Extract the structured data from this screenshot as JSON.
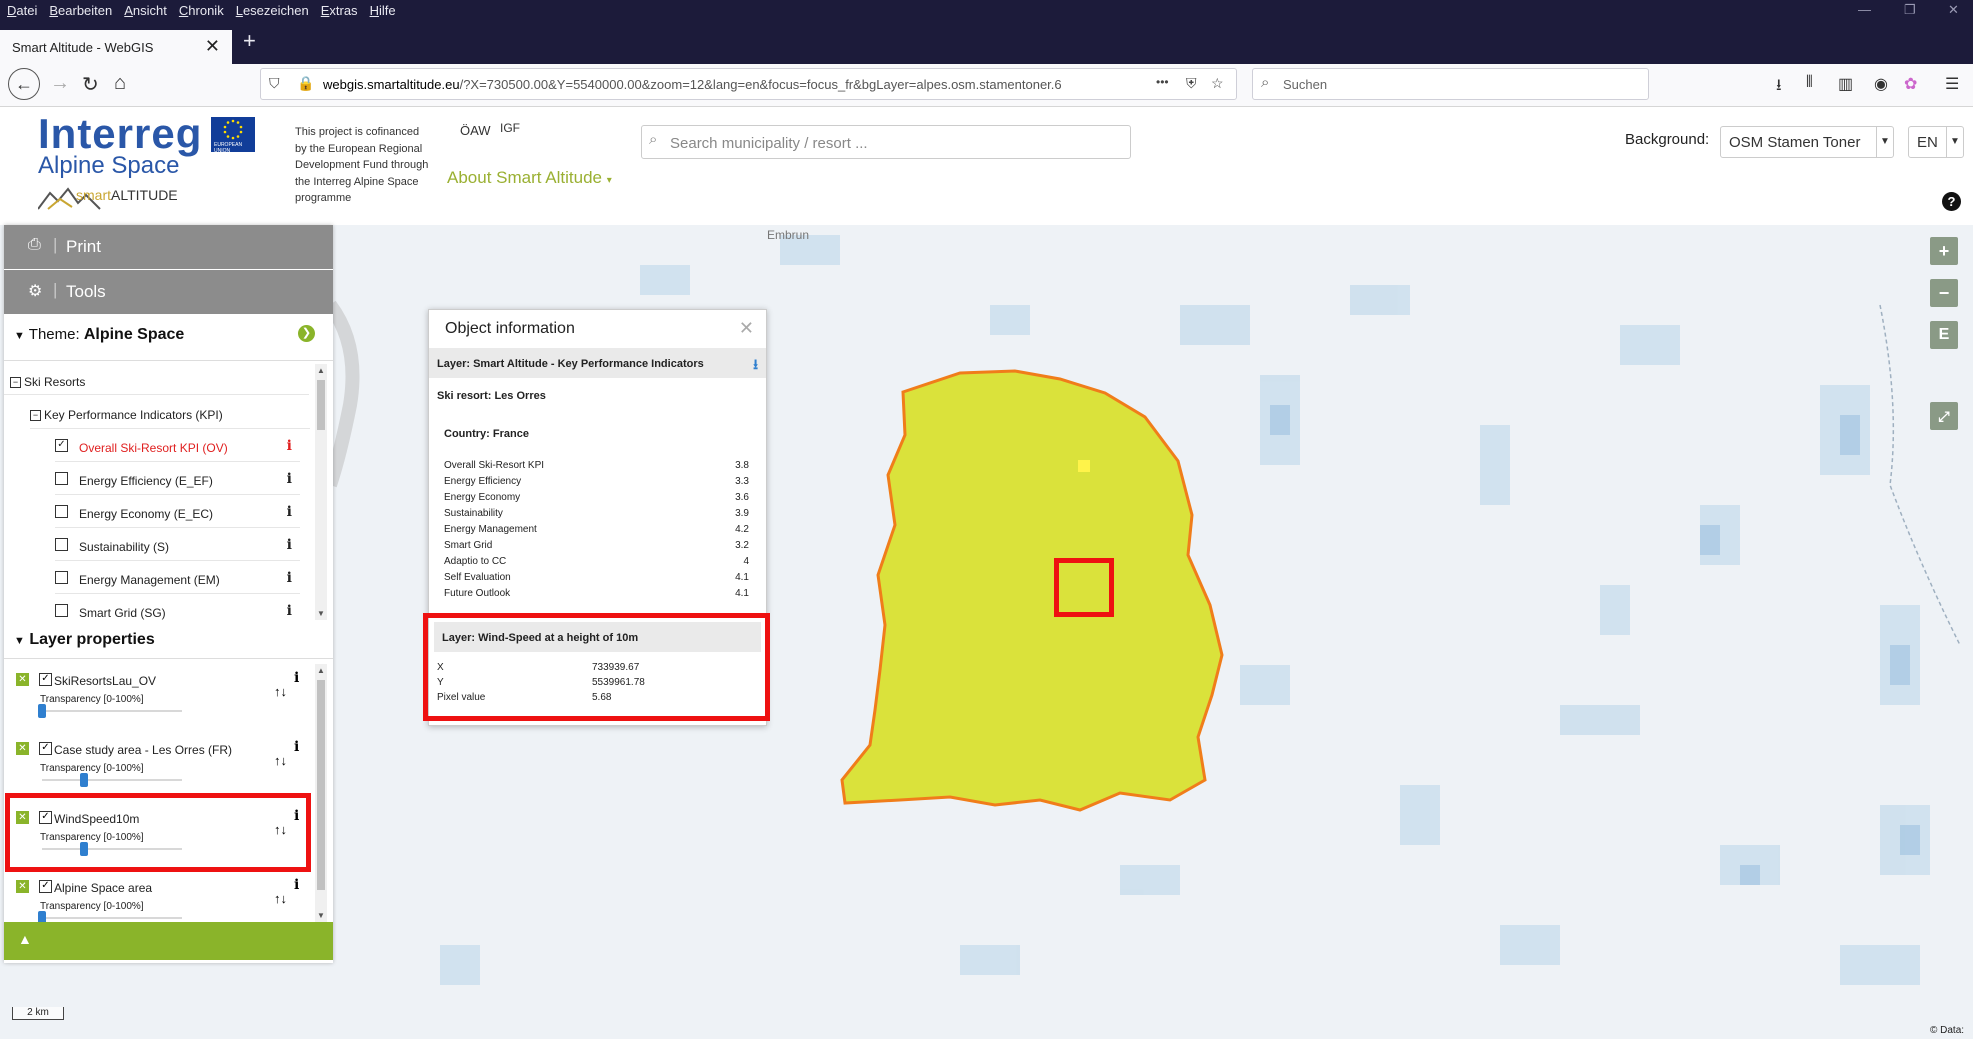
{
  "browser": {
    "menu": [
      "Datei",
      "Bearbeiten",
      "Ansicht",
      "Chronik",
      "Lesezeichen",
      "Extras",
      "Hilfe"
    ],
    "tab_title": "Smart Altitude - WebGIS",
    "url_host": "webgis.smartaltitude.eu",
    "url_path": "/?X=730500.00&Y=5540000.00&zoom=12&lang=en&focus=focus_fr&bgLayer=alpes.osm.stamentoner.6",
    "url_more": "•••",
    "search_placeholder": "Suchen"
  },
  "header": {
    "logo_main": "Interreg",
    "logo_sub": "Alpine Space",
    "eu_caption": "EUROPEAN UNION",
    "project_logo_smart": "smart",
    "project_logo_alt": "ALTITUDE",
    "funding_text": "This project is cofinanced by the European Regional Development Fund through the Interreg Alpine Space programme",
    "partner1": "ÖAW",
    "partner2": "IGF",
    "about_menu": "About Smart Altitude",
    "search_placeholder": "Search municipality / resort ...",
    "background_label": "Background:",
    "background_value": "OSM Stamen Toner",
    "language_value": "EN",
    "help_label": "?"
  },
  "sidebar": {
    "print_label": "Print",
    "tools_label": "Tools",
    "theme_label": "Theme:",
    "theme_value": "Alpine Space",
    "tree": {
      "root": "Ski Resorts",
      "group": "Key Performance Indicators (KPI)",
      "items": [
        {
          "label": "Overall Ski-Resort KPI (OV)",
          "checked": true,
          "active": true
        },
        {
          "label": "Energy Efficiency (E_EF)",
          "checked": false,
          "active": false
        },
        {
          "label": "Energy Economy (E_EC)",
          "checked": false,
          "active": false
        },
        {
          "label": "Sustainability (S)",
          "checked": false,
          "active": false
        },
        {
          "label": "Energy Management (EM)",
          "checked": false,
          "active": false
        },
        {
          "label": "Smart Grid (SG)",
          "checked": false,
          "active": false
        }
      ]
    },
    "layer_properties_title": "Layer properties",
    "layers": [
      {
        "name": "SkiResortsLau_OV",
        "transparency_label": "Transparency [0-100%]",
        "transparency": 0
      },
      {
        "name": "Case study area - Les Orres (FR)",
        "transparency_label": "Transparency [0-100%]",
        "transparency": 0.3
      },
      {
        "name": "WindSpeed10m",
        "transparency_label": "Transparency [0-100%]",
        "transparency": 0.3
      },
      {
        "name": "Alpine Space area",
        "transparency_label": "Transparency [0-100%]",
        "transparency": 0
      }
    ]
  },
  "map": {
    "place_label": "Embrun",
    "zoom_in": "+",
    "zoom_out": "−",
    "extent_btn": "E",
    "scale_label": "2 km",
    "attribution": "© Data:"
  },
  "popup": {
    "title": "Object information",
    "layer1_title": "Layer: Smart Altitude - Key Performance Indicators",
    "ski_resort": "Ski resort: Les Orres",
    "country": "Country: France",
    "kpis": [
      {
        "label": "Overall Ski-Resort KPI",
        "value": "3.8"
      },
      {
        "label": "Energy Efficiency",
        "value": "3.3"
      },
      {
        "label": "Energy Economy",
        "value": "3.6"
      },
      {
        "label": "Sustainability",
        "value": "3.9"
      },
      {
        "label": "Energy Management",
        "value": "4.2"
      },
      {
        "label": "Smart Grid",
        "value": "3.2"
      },
      {
        "label": "Adaptio to CC",
        "value": "4"
      },
      {
        "label": "Self Evaluation",
        "value": "4.1"
      },
      {
        "label": "Future Outlook",
        "value": "4.1"
      }
    ],
    "layer2_title": "Layer: Wind-Speed at a height of 10m",
    "layer2_rows": [
      {
        "label": "X",
        "value": "733939.67"
      },
      {
        "label": "Y",
        "value": "5539961.78"
      },
      {
        "label": "Pixel value",
        "value": "5.68"
      }
    ]
  },
  "colors": {
    "polygon_fill": "#d6df1a",
    "polygon_stroke": "#f07d1a",
    "highlight": "#ee1111",
    "accent_green": "#8ab42a"
  }
}
